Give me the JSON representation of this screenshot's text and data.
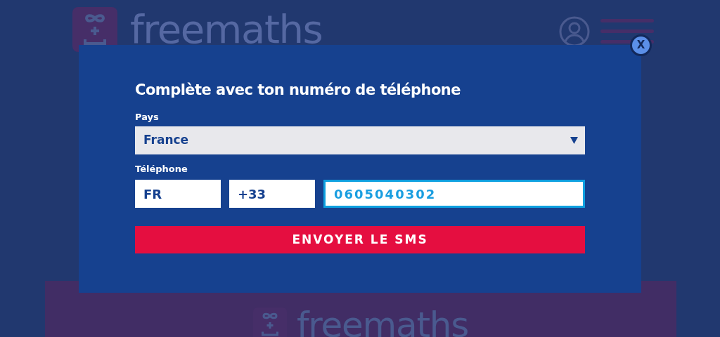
{
  "header": {
    "logo_text": "freemaths"
  },
  "dialog": {
    "close_label": "X",
    "title": "Complète avec ton numéro de téléphone",
    "country": {
      "label": "Pays",
      "value": "France"
    },
    "phone": {
      "label": "Téléphone",
      "fields": [
        {
          "value": "FR",
          "focused": false
        },
        {
          "value": "+33",
          "focused": false
        },
        {
          "value": "0605040302",
          "focused": true
        }
      ]
    },
    "submit": "ENVOYER LE SMS"
  },
  "footer": {
    "logo_text": "freemaths"
  }
}
